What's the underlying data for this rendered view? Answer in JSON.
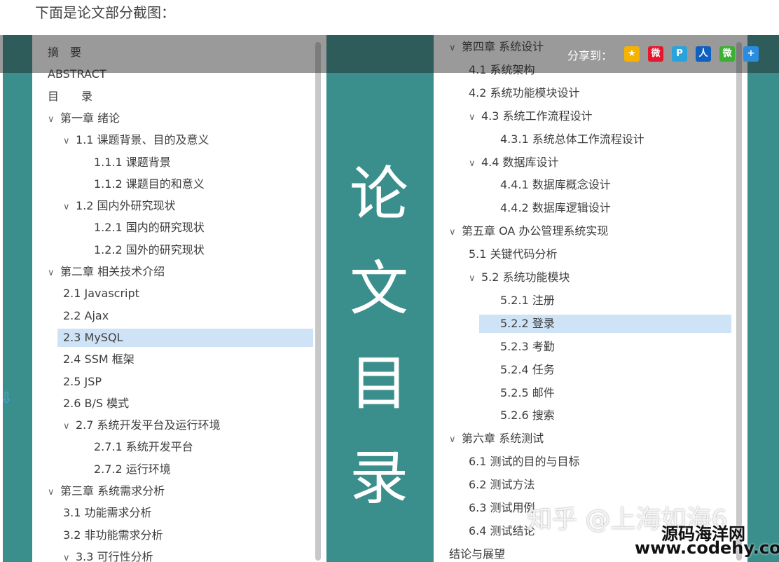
{
  "caption": "下面是论文部分截图：",
  "big_title": [
    "论",
    "文",
    "目",
    "录"
  ],
  "share": {
    "label": "分享到：",
    "icons": [
      {
        "name": "qzone-icon",
        "color": "#f5b300",
        "glyph": "★"
      },
      {
        "name": "weibo-icon",
        "color": "#e6162d",
        "glyph": "微"
      },
      {
        "name": "tencent-icon",
        "color": "#2aa3dd",
        "glyph": "P"
      },
      {
        "name": "renren-icon",
        "color": "#1060c0",
        "glyph": "人"
      },
      {
        "name": "wechat-icon",
        "color": "#3cb034",
        "glyph": "微"
      },
      {
        "name": "more-icon",
        "color": "#2b8de0",
        "glyph": "+"
      }
    ]
  },
  "left_toc": [
    {
      "text": "摘　要",
      "level": 0,
      "chevron": false
    },
    {
      "text": "ABSTRACT",
      "level": 0,
      "chevron": false
    },
    {
      "text": "目　　录",
      "level": 0,
      "chevron": false
    },
    {
      "text": "第一章 绪论",
      "level": 0,
      "chevron": true
    },
    {
      "text": "1.1 课题背景、目的及意义",
      "level": 1,
      "chevron": true
    },
    {
      "text": "1.1.1 课题背景",
      "level": 2,
      "chevron": false
    },
    {
      "text": "1.1.2 课题目的和意义",
      "level": 2,
      "chevron": false
    },
    {
      "text": "1.2 国内外研究现状",
      "level": 1,
      "chevron": true
    },
    {
      "text": "1.2.1 国内的研究现状",
      "level": 2,
      "chevron": false
    },
    {
      "text": "1.2.2 国外的研究现状",
      "level": 2,
      "chevron": false
    },
    {
      "text": "第二章 相关技术介绍",
      "level": 0,
      "chevron": true
    },
    {
      "text": "2.1 Javascript",
      "level": 1,
      "chevron": false
    },
    {
      "text": "2.2 Ajax",
      "level": 1,
      "chevron": false
    },
    {
      "text": "2.3 MySQL",
      "level": 1,
      "chevron": false,
      "highlight": true
    },
    {
      "text": "2.4 SSM 框架",
      "level": 1,
      "chevron": false
    },
    {
      "text": "2.5 JSP",
      "level": 1,
      "chevron": false
    },
    {
      "text": "2.6 B/S 模式",
      "level": 1,
      "chevron": false
    },
    {
      "text": "2.7 系统开发平台及运行环境",
      "level": 1,
      "chevron": true
    },
    {
      "text": "2.7.1 系统开发平台",
      "level": 2,
      "chevron": false
    },
    {
      "text": "2.7.2 运行环境",
      "level": 2,
      "chevron": false
    },
    {
      "text": "第三章 系统需求分析",
      "level": 0,
      "chevron": true
    },
    {
      "text": "3.1 功能需求分析",
      "level": 1,
      "chevron": false
    },
    {
      "text": "3.2 非功能需求分析",
      "level": 1,
      "chevron": false
    },
    {
      "text": "3.3 可行性分析",
      "level": 1,
      "chevron": true
    }
  ],
  "right_toc": [
    {
      "text": "第四章 系统设计",
      "level": 0,
      "chevron": true
    },
    {
      "text": "4.1 系统架构",
      "level": 1,
      "chevron": false
    },
    {
      "text": "4.2 系统功能模块设计",
      "level": 1,
      "chevron": false
    },
    {
      "text": "4.3 系统工作流程设计",
      "level": 1,
      "chevron": true
    },
    {
      "text": "4.3.1 系统总体工作流程设计",
      "level": 2,
      "chevron": false
    },
    {
      "text": "4.4 数据库设计",
      "level": 1,
      "chevron": true
    },
    {
      "text": "4.4.1 数据库概念设计",
      "level": 2,
      "chevron": false
    },
    {
      "text": "4.4.2 数据库逻辑设计",
      "level": 2,
      "chevron": false
    },
    {
      "text": "第五章 OA 办公管理系统实现",
      "level": 0,
      "chevron": true
    },
    {
      "text": "5.1 关键代码分析",
      "level": 1,
      "chevron": false
    },
    {
      "text": "5.2 系统功能模块",
      "level": 1,
      "chevron": true
    },
    {
      "text": "5.2.1 注册",
      "level": 2,
      "chevron": false
    },
    {
      "text": "5.2.2 登录",
      "level": 2,
      "chevron": false,
      "highlight": true
    },
    {
      "text": "5.2.3 考勤",
      "level": 2,
      "chevron": false
    },
    {
      "text": "5.2.4 任务",
      "level": 2,
      "chevron": false
    },
    {
      "text": "5.2.5 邮件",
      "level": 2,
      "chevron": false
    },
    {
      "text": "5.2.6 搜索",
      "level": 2,
      "chevron": false
    },
    {
      "text": "第六章 系统测试",
      "level": 0,
      "chevron": true
    },
    {
      "text": "6.1 测试的目的与目标",
      "level": 1,
      "chevron": false
    },
    {
      "text": "6.2 测试方法",
      "level": 1,
      "chevron": false
    },
    {
      "text": "6.3 测试用例",
      "level": 1,
      "chevron": false
    },
    {
      "text": "6.4 测试结论",
      "level": 1,
      "chevron": false
    },
    {
      "text": "结论与展望",
      "level": 0,
      "chevron": false
    }
  ],
  "watermarks": {
    "zhihu": "知乎 @上海如海6",
    "site_cn": "源码海洋网",
    "site_url": "www.codehy.com"
  },
  "colors": {
    "teal": "#3a8f8c",
    "highlight": "#cfe3f6"
  }
}
